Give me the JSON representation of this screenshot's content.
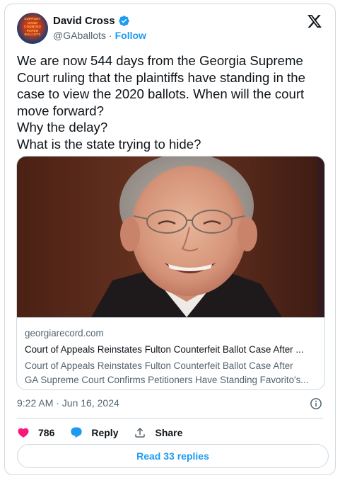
{
  "author": {
    "display_name": "David Cross",
    "handle": "@GAballots",
    "separator": "·",
    "follow_label": "Follow",
    "avatar_text": [
      "SUPPORT",
      "HAND",
      "COUNTED",
      "PAPER",
      "BALLOTS"
    ],
    "verified_color": "#1d9bf0"
  },
  "tweet": {
    "lines": [
      "We are now 544 days from the Georgia Supreme",
      "Court ruling that the plaintiffs have standing in the",
      "case to view the 2020 ballots. When will the court",
      "move forward?",
      "Why the delay?",
      "What is the state trying to hide?"
    ]
  },
  "link_card": {
    "domain": "georgiarecord.com",
    "title": "Court of Appeals Reinstates Fulton Counterfeit Ballot Case After ...",
    "description_lines": [
      "Court of Appeals Reinstates Fulton Counterfeit Ballot Case After",
      "GA Supreme Court Confirms Petitioners Have Standing Favorito's..."
    ]
  },
  "timestamp": "9:22 AM · Jun 16, 2024",
  "actions": {
    "likes_count": "786",
    "reply_label": "Reply",
    "share_label": "Share"
  },
  "read_replies_label": "Read 33 replies",
  "colors": {
    "accent": "#1d9bf0",
    "like": "#f91880",
    "secondary_text": "#536471",
    "border": "#cfd9de"
  },
  "icons": [
    "verified-badge-icon",
    "x-logo-icon",
    "info-icon",
    "heart-icon",
    "reply-bubble-icon",
    "share-icon"
  ]
}
